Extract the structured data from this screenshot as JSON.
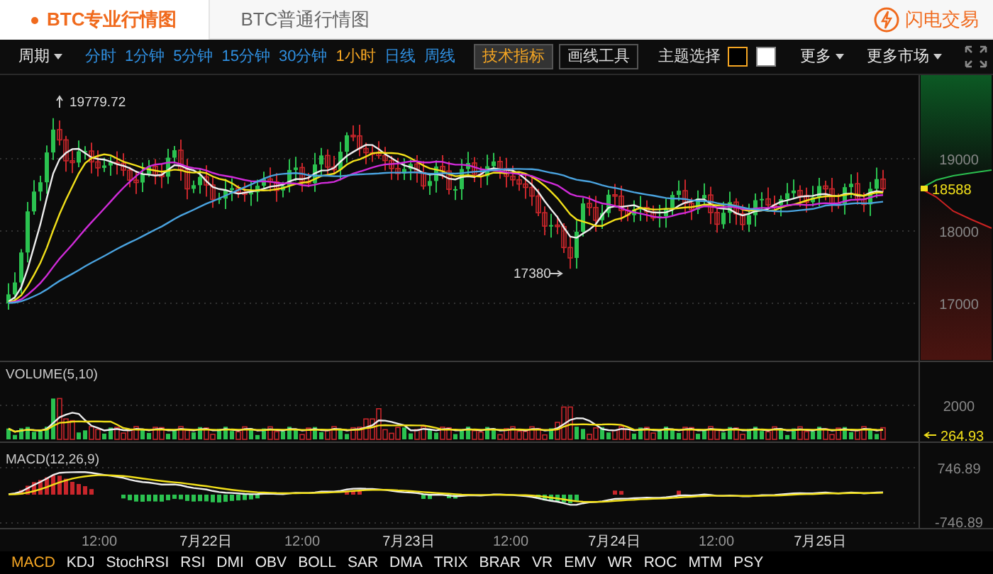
{
  "tabs": [
    {
      "label": "BTC专业行情图",
      "selected": true
    },
    {
      "label": "BTC普通行情图",
      "selected": false
    }
  ],
  "quick_trade": {
    "label": "闪电交易"
  },
  "toolbar": {
    "period_menu": "周期",
    "intervals": [
      {
        "label": "分时",
        "selected": false
      },
      {
        "label": "1分钟",
        "selected": false
      },
      {
        "label": "5分钟",
        "selected": false
      },
      {
        "label": "15分钟",
        "selected": false
      },
      {
        "label": "30分钟",
        "selected": false
      },
      {
        "label": "1小时",
        "selected": true
      },
      {
        "label": "日线",
        "selected": false
      },
      {
        "label": "周线",
        "selected": false
      }
    ],
    "buttons": [
      {
        "label": "技术指标",
        "selected": true
      },
      {
        "label": "画线工具",
        "selected": false
      }
    ],
    "theme_label": "主题选择",
    "themes": [
      {
        "color": "#000000",
        "selected": true
      },
      {
        "color": "#ffffff",
        "selected": false
      }
    ],
    "menus": [
      "更多",
      "更多市场"
    ]
  },
  "price_chart": {
    "y_labels": [
      "19000",
      "18000",
      "17000"
    ],
    "high_label": "19779.72",
    "low_label": "17380",
    "last_price": "18588"
  },
  "volume_chart": {
    "title": "VOLUME(5,10)",
    "y_label": "2000",
    "last_value": "264.93"
  },
  "macd_chart": {
    "title": "MACD(12,26,9)",
    "y_labels": [
      "746.89",
      "-746.89"
    ]
  },
  "x_axis": [
    "12:00",
    "7月22日",
    "12:00",
    "7月23日",
    "12:00",
    "7月24日",
    "12:00",
    "7月25日"
  ],
  "indicators": [
    {
      "label": "MACD",
      "selected": true
    },
    {
      "label": "KDJ",
      "selected": false
    },
    {
      "label": "StochRSI",
      "selected": false
    },
    {
      "label": "RSI",
      "selected": false
    },
    {
      "label": "DMI",
      "selected": false
    },
    {
      "label": "OBV",
      "selected": false
    },
    {
      "label": "BOLL",
      "selected": false
    },
    {
      "label": "SAR",
      "selected": false
    },
    {
      "label": "DMA",
      "selected": false
    },
    {
      "label": "TRIX",
      "selected": false
    },
    {
      "label": "BRAR",
      "selected": false
    },
    {
      "label": "VR",
      "selected": false
    },
    {
      "label": "EMV",
      "selected": false
    },
    {
      "label": "WR",
      "selected": false
    },
    {
      "label": "ROC",
      "selected": false
    },
    {
      "label": "MTM",
      "selected": false
    },
    {
      "label": "PSY",
      "selected": false
    }
  ]
}
